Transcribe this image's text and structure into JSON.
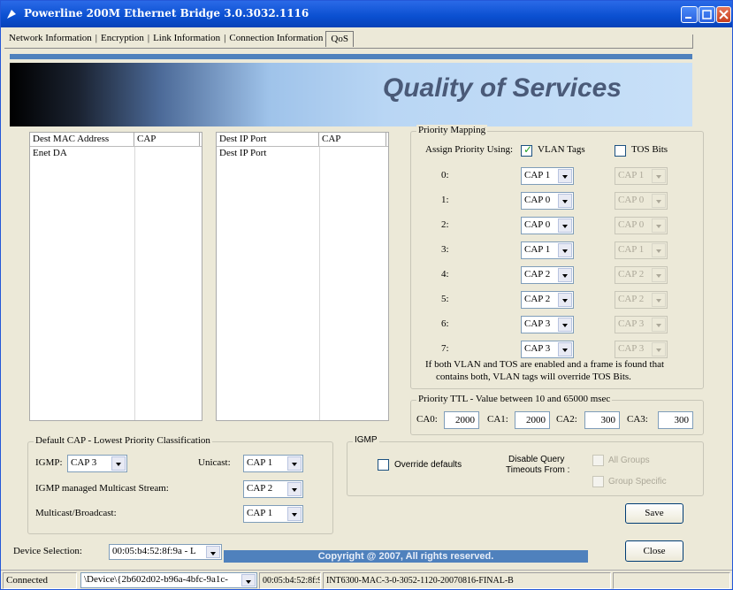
{
  "window": {
    "title": "Powerline 200M Ethernet Bridge 3.0.3032.1116"
  },
  "tabs": [
    {
      "label": "Network Information"
    },
    {
      "label": "Encryption"
    },
    {
      "label": "Link Information"
    },
    {
      "label": "Connection Information"
    },
    {
      "label": "QoS"
    }
  ],
  "banner": {
    "title": "Quality of Services"
  },
  "mac_list": {
    "columns": [
      "Dest MAC Address",
      "CAP"
    ],
    "rows": [
      [
        "Enet DA",
        ""
      ]
    ]
  },
  "ip_list": {
    "columns": [
      "Dest IP Port",
      "CAP"
    ],
    "rows": [
      [
        "Dest IP Port",
        ""
      ]
    ]
  },
  "priority_mapping": {
    "legend": "Priority Mapping",
    "assign_label": "Assign Priority Using:",
    "vlan_label": "VLAN Tags",
    "vlan_checked": true,
    "tos_label": "TOS Bits",
    "tos_checked": false,
    "rows": [
      {
        "label": "0:",
        "vlan": "CAP 1",
        "tos": "CAP 1"
      },
      {
        "label": "1:",
        "vlan": "CAP 0",
        "tos": "CAP 0"
      },
      {
        "label": "2:",
        "vlan": "CAP 0",
        "tos": "CAP 0"
      },
      {
        "label": "3:",
        "vlan": "CAP 1",
        "tos": "CAP 1"
      },
      {
        "label": "4:",
        "vlan": "CAP 2",
        "tos": "CAP 2"
      },
      {
        "label": "5:",
        "vlan": "CAP 2",
        "tos": "CAP 2"
      },
      {
        "label": "6:",
        "vlan": "CAP 3",
        "tos": "CAP 3"
      },
      {
        "label": "7:",
        "vlan": "CAP 3",
        "tos": "CAP 3"
      }
    ],
    "note_line1": "If both VLAN and TOS are enabled and a frame is found that",
    "note_line2": "contains both, VLAN tags will override TOS Bits."
  },
  "priority_ttl": {
    "legend": "Priority TTL - Value between 10 and 65000 msec",
    "ca0_label": "CA0:",
    "ca0": "2000",
    "ca1_label": "CA1:",
    "ca1": "2000",
    "ca2_label": "CA2:",
    "ca2": "300",
    "ca3_label": "CA3:",
    "ca3": "300"
  },
  "default_cap": {
    "legend": "Default CAP - Lowest Priority Classification",
    "igmp_label": "IGMP:",
    "igmp": "CAP 3",
    "unicast_label": "Unicast:",
    "unicast": "CAP 1",
    "igmp_stream_label": "IGMP managed Multicast Stream:",
    "igmp_stream": "CAP 2",
    "multicast_label": "Multicast/Broadcast:",
    "multicast": "CAP 1"
  },
  "igmp": {
    "legend": "IGMP",
    "override_label": "Override defaults",
    "override_checked": false,
    "disable_label_1": "Disable Query",
    "disable_label_2": "Timeouts From :",
    "all_groups_label": "All Groups",
    "group_specific_label": "Group Specific"
  },
  "buttons": {
    "save": "Save",
    "close": "Close"
  },
  "device_selection": {
    "label": "Device Selection:",
    "value": "00:05:b4:52:8f:9a - L"
  },
  "copyright": "Copyright @ 2007, All rights reserved.",
  "status": {
    "state": "Connected",
    "device_path": "\\Device\\{2b602d02-b96a-4bfc-9a1c-",
    "mac": "00:05:b4:52:8f:9a",
    "firmware": "INT6300-MAC-3-0-3052-1120-20070816-FINAL-B"
  },
  "colors": {
    "titlebar": "#0a4fd0",
    "accent_strip": "#4f81bd",
    "banner_text": "#4a5a78"
  }
}
